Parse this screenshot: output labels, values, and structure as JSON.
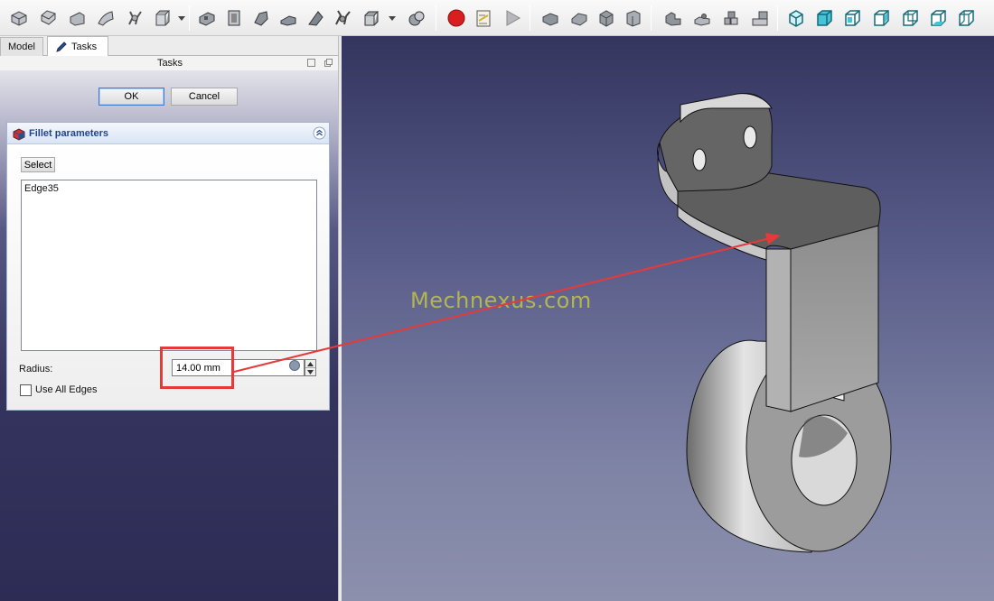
{
  "toolbar": {
    "groups": [
      [
        "fillet-icon",
        "chamfer-icon",
        "face-icon",
        "ruled-surface-icon",
        "loft-icon",
        "sweep-icon"
      ],
      [
        "section-icon",
        "cross-sections-icon",
        "offset-icon",
        "thickness-icon",
        "projection-icon",
        "extrude-icon"
      ],
      [
        "record-macro-icon",
        "macro-editor-icon",
        "run-macro-icon"
      ],
      [
        "box-view-icon",
        "front-view-icon",
        "top-view-icon",
        "right-view-icon",
        "rear-view-icon",
        "bottom-view-icon",
        "left-view-icon"
      ],
      [
        "isometric-view-icon",
        "axo-view-icon",
        "wireframe-view-icon"
      ]
    ]
  },
  "tabs": {
    "model": "Model",
    "tasks": "Tasks"
  },
  "tasks_panel": {
    "title": "Tasks"
  },
  "dialog": {
    "ok_label": "OK",
    "cancel_label": "Cancel"
  },
  "fillet": {
    "title": "Fillet parameters",
    "select_label": "Select",
    "edges": [
      "Edge35"
    ],
    "radius_label": "Radius:",
    "radius_value": "14.00 mm",
    "use_all_edges_label": "Use All Edges",
    "use_all_edges_checked": false
  },
  "viewport": {
    "watermark": "Mechnexus.com"
  },
  "colors": {
    "accent": "#21458c",
    "highlight": "#e53a3a",
    "watermark": "#b3b551"
  }
}
